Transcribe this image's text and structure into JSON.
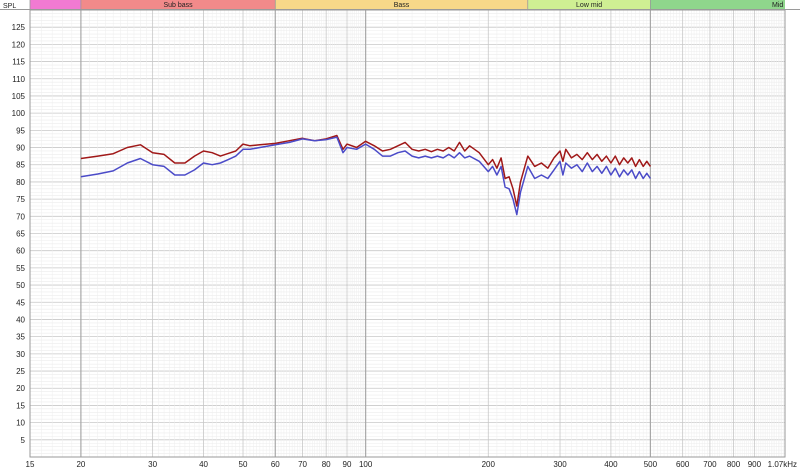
{
  "chart_data": {
    "type": "line",
    "title": "",
    "ylabel": "SPL",
    "xlabel": "",
    "xscale": "log",
    "xlim": [
      15,
      1070
    ],
    "ylim": [
      0,
      130
    ],
    "grid": true,
    "bands": [
      {
        "label": "",
        "from": 15,
        "to": 20,
        "color": "#f27ad2"
      },
      {
        "label": "Sub bass",
        "from": 20,
        "to": 60,
        "color": "#f28a8a"
      },
      {
        "label": "Bass",
        "from": 60,
        "to": 250,
        "color": "#f7d889"
      },
      {
        "label": "Low mid",
        "from": 250,
        "to": 500,
        "color": "#cfef93"
      },
      {
        "label": "Mid",
        "from": 500,
        "to": 1070,
        "color": "#8fd68c"
      }
    ],
    "x_tick_labels": [
      {
        "value": 15,
        "label": "15"
      },
      {
        "value": 20,
        "label": "20"
      },
      {
        "value": 30,
        "label": "30"
      },
      {
        "value": 40,
        "label": "40"
      },
      {
        "value": 50,
        "label": "50"
      },
      {
        "value": 60,
        "label": "60"
      },
      {
        "value": 70,
        "label": "70"
      },
      {
        "value": 80,
        "label": "80"
      },
      {
        "value": 90,
        "label": "90"
      },
      {
        "value": 100,
        "label": "100"
      },
      {
        "value": 200,
        "label": "200"
      },
      {
        "value": 300,
        "label": "300"
      },
      {
        "value": 400,
        "label": "400"
      },
      {
        "value": 500,
        "label": "500"
      },
      {
        "value": 600,
        "label": "600"
      },
      {
        "value": 700,
        "label": "700"
      },
      {
        "value": 800,
        "label": "800"
      },
      {
        "value": 900,
        "label": "900"
      },
      {
        "value": 1070,
        "label": "1.07kHz"
      }
    ],
    "y_tick_labels": [
      "5",
      "10",
      "15",
      "20",
      "25",
      "30",
      "35",
      "40",
      "45",
      "50",
      "55",
      "60",
      "65",
      "70",
      "75",
      "80",
      "85",
      "90",
      "95",
      "100",
      "105",
      "110",
      "115",
      "120",
      "125"
    ],
    "series": [
      {
        "color": "#a01818",
        "x": [
          20,
          22,
          24,
          26,
          28,
          30,
          32,
          34,
          36,
          38,
          40,
          42,
          44,
          46,
          48,
          50,
          52,
          55,
          60,
          65,
          70,
          75,
          80,
          85,
          88,
          90,
          95,
          100,
          105,
          110,
          115,
          120,
          125,
          130,
          135,
          140,
          145,
          150,
          155,
          160,
          165,
          170,
          175,
          180,
          190,
          200,
          205,
          210,
          215,
          220,
          225,
          230,
          235,
          240,
          250,
          260,
          270,
          280,
          290,
          300,
          305,
          310,
          320,
          330,
          340,
          350,
          360,
          370,
          380,
          390,
          400,
          410,
          420,
          430,
          440,
          450,
          460,
          470,
          480,
          490,
          500
        ],
        "y": [
          86.8,
          87.5,
          88.2,
          90,
          90.8,
          88.5,
          88,
          85.5,
          85.5,
          87.5,
          89,
          88.5,
          87.5,
          88.3,
          89,
          91,
          90.5,
          90.8,
          91.2,
          92,
          92.7,
          92,
          92.5,
          93.5,
          89.5,
          91,
          90,
          91.8,
          90.5,
          89,
          89.5,
          90.5,
          91.5,
          89.5,
          89,
          89.5,
          88.8,
          89.5,
          89,
          90,
          89,
          91.5,
          89,
          90.5,
          88.5,
          85,
          86.5,
          84,
          87,
          81,
          81.5,
          78,
          73,
          80,
          87.5,
          84.5,
          85.5,
          84,
          87,
          89,
          86,
          89.5,
          87,
          88,
          86.5,
          88.5,
          86.5,
          88,
          86,
          87.5,
          85.5,
          87.5,
          85,
          87,
          85.5,
          87,
          84.5,
          86.5,
          84.5,
          86,
          84.5
        ]
      },
      {
        "color": "#4b4bc8",
        "x": [
          20,
          22,
          24,
          26,
          28,
          30,
          32,
          34,
          36,
          38,
          40,
          42,
          44,
          46,
          48,
          50,
          52,
          55,
          60,
          65,
          70,
          75,
          80,
          85,
          88,
          90,
          95,
          100,
          105,
          110,
          115,
          120,
          125,
          130,
          135,
          140,
          145,
          150,
          155,
          160,
          165,
          170,
          175,
          180,
          190,
          200,
          205,
          210,
          215,
          220,
          225,
          230,
          235,
          240,
          250,
          260,
          270,
          280,
          290,
          300,
          305,
          310,
          320,
          330,
          340,
          350,
          360,
          370,
          380,
          390,
          400,
          410,
          420,
          430,
          440,
          450,
          460,
          470,
          480,
          490,
          500
        ],
        "y": [
          81.5,
          82.3,
          83.2,
          85.5,
          86.8,
          85,
          84.5,
          82,
          82,
          83.5,
          85.5,
          85,
          85.5,
          86.5,
          87.5,
          89.5,
          89.5,
          90,
          90.8,
          91.5,
          92.5,
          92,
          92.3,
          93,
          88.5,
          90,
          89.5,
          91,
          89.5,
          87.5,
          87.5,
          88.5,
          89,
          87.5,
          87,
          87.5,
          87,
          87.5,
          87,
          88,
          87,
          88.5,
          87,
          87.5,
          86,
          83,
          84.5,
          82,
          84.5,
          78.5,
          78,
          75,
          70.5,
          77,
          84.5,
          81,
          82,
          81,
          83.5,
          86,
          82,
          85.5,
          84,
          85,
          83,
          85.5,
          83,
          84.5,
          82.5,
          84.5,
          82,
          84,
          81.5,
          83.5,
          82,
          83.5,
          81,
          83,
          81,
          82.5,
          81
        ]
      }
    ]
  }
}
